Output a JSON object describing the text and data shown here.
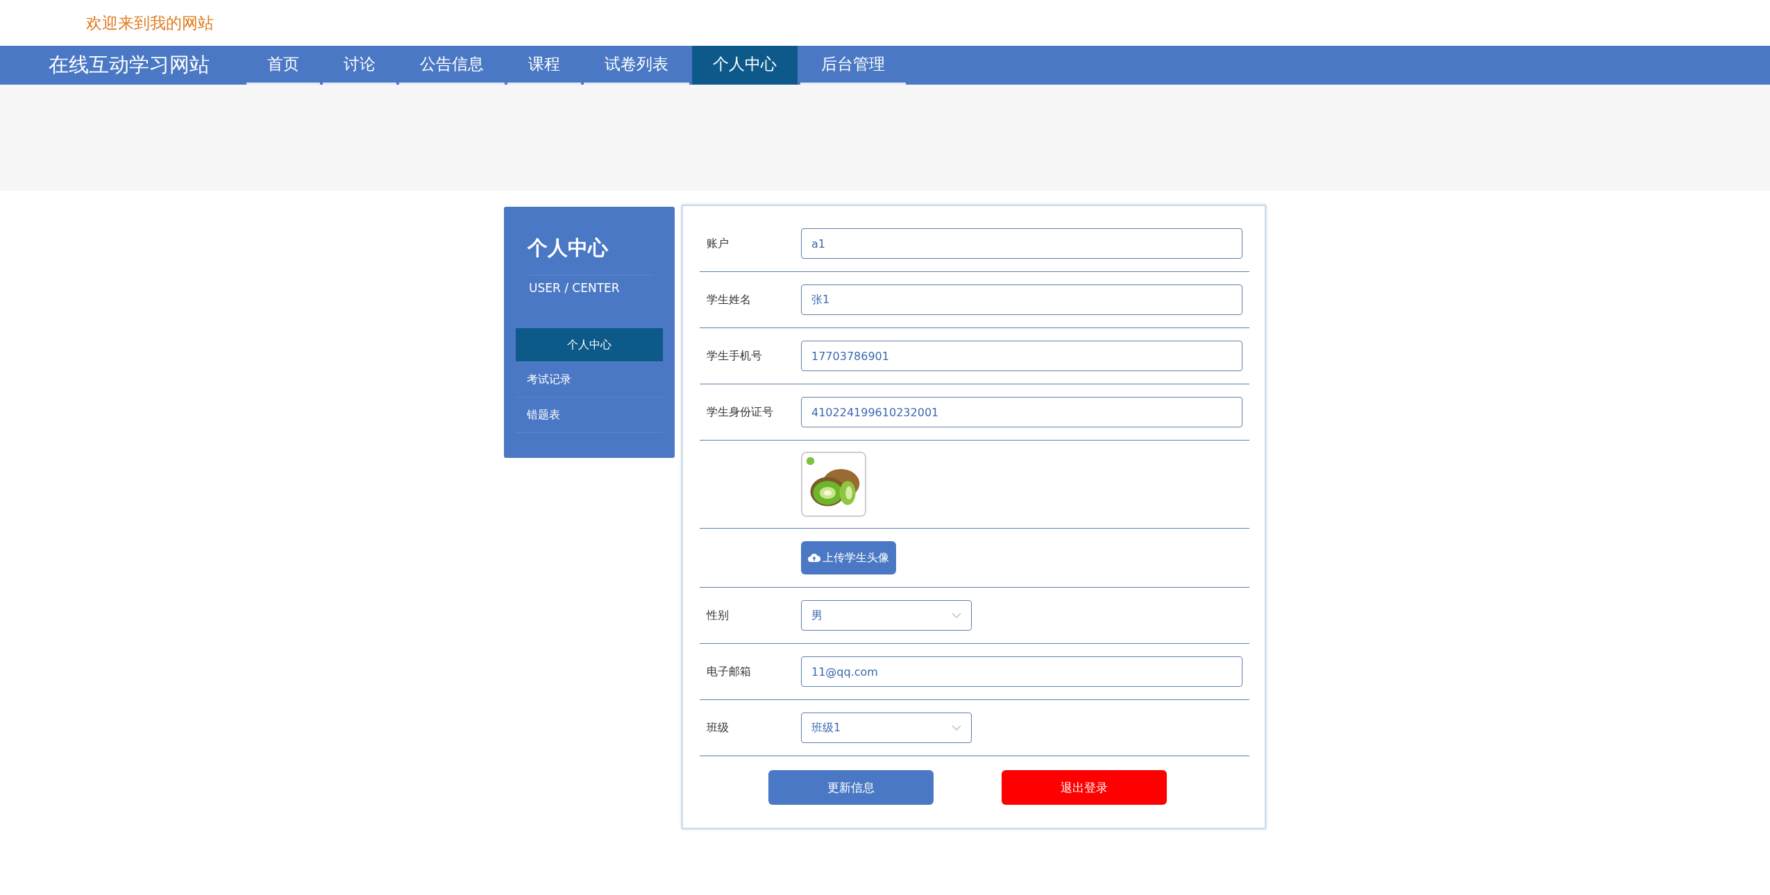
{
  "top_bar": {
    "welcome": "欢迎来到我的网站"
  },
  "nav": {
    "brand": "在线互动学习网站",
    "tabs": [
      {
        "label": "首页",
        "selected": false
      },
      {
        "label": "讨论",
        "selected": false
      },
      {
        "label": "公告信息",
        "selected": false
      },
      {
        "label": "课程",
        "selected": false
      },
      {
        "label": "试卷列表",
        "selected": false
      },
      {
        "label": "个人中心",
        "selected": true
      },
      {
        "label": "后台管理",
        "selected": false
      }
    ]
  },
  "sidebar": {
    "title": "个人中心",
    "subtitle": "USER / CENTER",
    "items": [
      {
        "label": "个人中心",
        "selected": true
      },
      {
        "label": "考试记录",
        "selected": false
      },
      {
        "label": "错题表",
        "selected": false
      }
    ]
  },
  "form": {
    "fields": [
      {
        "kind": "text",
        "label": "账户",
        "value": "a1"
      },
      {
        "kind": "text",
        "label": "学生姓名",
        "value": "张1"
      },
      {
        "kind": "text",
        "label": "学生手机号",
        "value": "17703786901"
      },
      {
        "kind": "text",
        "label": "学生身份证号",
        "value": "410224199610232001"
      },
      {
        "kind": "avatar"
      },
      {
        "kind": "upload",
        "value": "上传学生头像"
      },
      {
        "kind": "select",
        "label": "性别",
        "value": "男"
      },
      {
        "kind": "text",
        "label": "电子邮箱",
        "value": "11@qq.com"
      },
      {
        "kind": "select",
        "label": "班级",
        "value": "班级1"
      }
    ],
    "buttons": [
      {
        "kind": "primary",
        "label": "更新信息"
      },
      {
        "kind": "danger",
        "label": "退出登录"
      }
    ]
  }
}
